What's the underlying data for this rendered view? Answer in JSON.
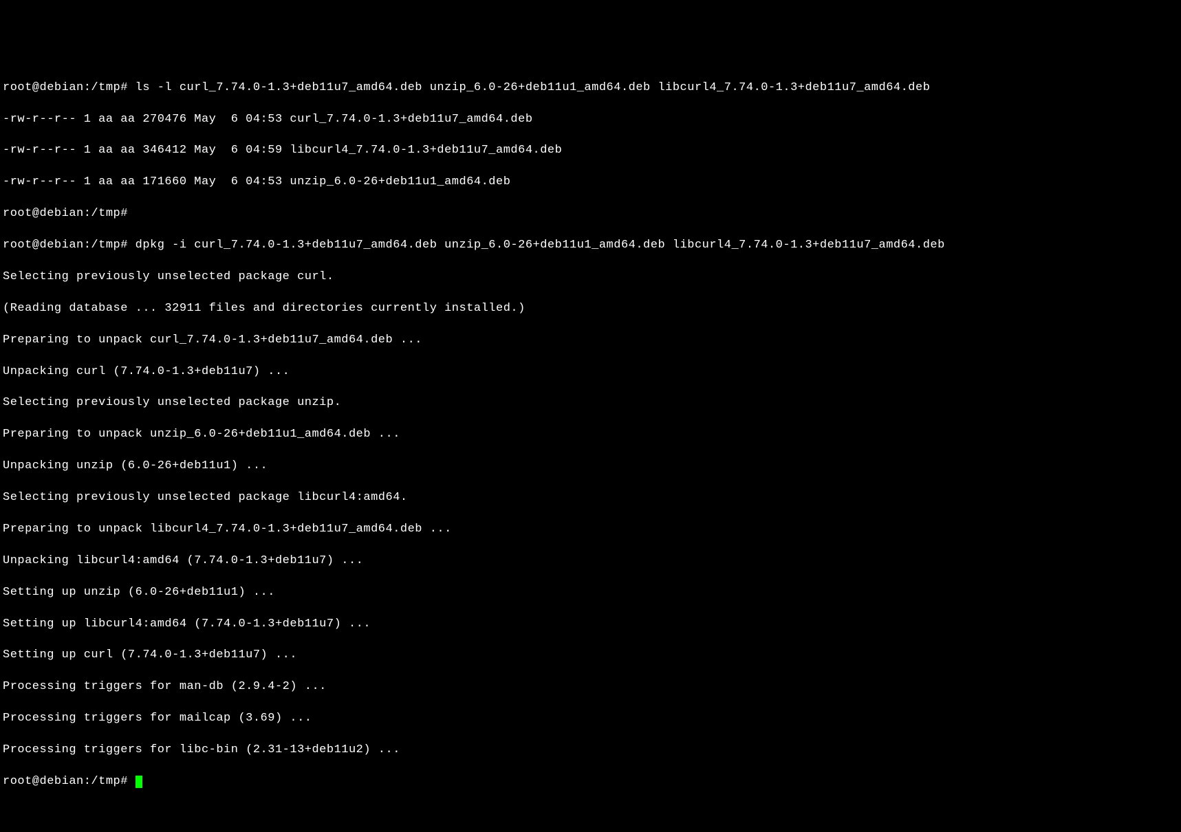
{
  "lines": [
    "root@debian:/tmp# ls -l curl_7.74.0-1.3+deb11u7_amd64.deb unzip_6.0-26+deb11u1_amd64.deb libcurl4_7.74.0-1.3+deb11u7_amd64.deb",
    "-rw-r--r-- 1 aa aa 270476 May  6 04:53 curl_7.74.0-1.3+deb11u7_amd64.deb",
    "-rw-r--r-- 1 aa aa 346412 May  6 04:59 libcurl4_7.74.0-1.3+deb11u7_amd64.deb",
    "-rw-r--r-- 1 aa aa 171660 May  6 04:53 unzip_6.0-26+deb11u1_amd64.deb",
    "root@debian:/tmp#",
    "root@debian:/tmp# dpkg -i curl_7.74.0-1.3+deb11u7_amd64.deb unzip_6.0-26+deb11u1_amd64.deb libcurl4_7.74.0-1.3+deb11u7_amd64.deb",
    "Selecting previously unselected package curl.",
    "(Reading database ... 32911 files and directories currently installed.)",
    "Preparing to unpack curl_7.74.0-1.3+deb11u7_amd64.deb ...",
    "Unpacking curl (7.74.0-1.3+deb11u7) ...",
    "Selecting previously unselected package unzip.",
    "Preparing to unpack unzip_6.0-26+deb11u1_amd64.deb ...",
    "Unpacking unzip (6.0-26+deb11u1) ...",
    "Selecting previously unselected package libcurl4:amd64.",
    "Preparing to unpack libcurl4_7.74.0-1.3+deb11u7_amd64.deb ...",
    "Unpacking libcurl4:amd64 (7.74.0-1.3+deb11u7) ...",
    "Setting up unzip (6.0-26+deb11u1) ...",
    "Setting up libcurl4:amd64 (7.74.0-1.3+deb11u7) ...",
    "Setting up curl (7.74.0-1.3+deb11u7) ...",
    "Processing triggers for man-db (2.9.4-2) ...",
    "Processing triggers for mailcap (3.69) ...",
    "Processing triggers for libc-bin (2.31-13+deb11u2) ...",
    "root@debian:/tmp# "
  ],
  "prompt_final": "root@debian:/tmp# "
}
